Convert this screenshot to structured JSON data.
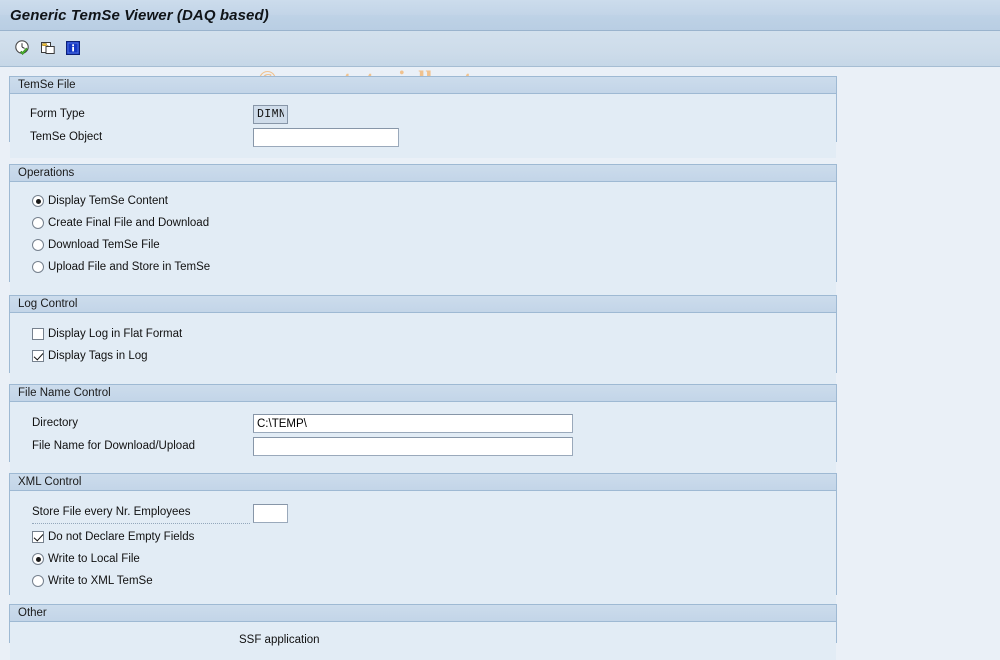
{
  "window": {
    "title": "Generic TemSe Viewer (DAQ based)"
  },
  "watermark": {
    "text": "© www.tutorialkart.com",
    "color": "#f0c28f"
  },
  "toolbar": {
    "items": [
      {
        "name": "execute-icon",
        "tooltip": "Execute"
      },
      {
        "name": "copy-icon",
        "tooltip": "Copy"
      },
      {
        "name": "info-icon",
        "tooltip": "Information"
      }
    ]
  },
  "sections": {
    "temse_file": {
      "header": "TemSe File",
      "form_type_label": "Form Type",
      "form_type_value": "DIMN",
      "temse_object_label": "TemSe Object",
      "temse_object_value": "",
      "temse_object_placeholder": ""
    },
    "operations": {
      "header": "Operations",
      "options": [
        {
          "label": "Display TemSe Content",
          "selected": true
        },
        {
          "label": "Create Final File and Download",
          "selected": false
        },
        {
          "label": "Download TemSe File",
          "selected": false
        },
        {
          "label": "Upload File and Store in TemSe",
          "selected": false
        }
      ]
    },
    "log_control": {
      "header": "Log Control",
      "options": [
        {
          "label": "Display Log in Flat Format",
          "checked": false
        },
        {
          "label": "Display Tags in Log",
          "checked": true
        }
      ]
    },
    "file_name_control": {
      "header": "File Name Control",
      "directory_label": "Directory",
      "directory_value": "C:\\TEMP\\",
      "filename_label": "File Name for Download/Upload",
      "filename_value": "",
      "filename_placeholder": ""
    },
    "xml_control": {
      "header": "XML Control",
      "store_file_label": "Store File every Nr. Employees",
      "store_file_value": "",
      "store_file_placeholder": "",
      "checkbox": {
        "label": "Do not Declare Empty Fields",
        "checked": true
      },
      "radios": [
        {
          "label": "Write to Local File",
          "selected": true
        },
        {
          "label": "Write to XML TemSe",
          "selected": false
        }
      ]
    },
    "other": {
      "header": "Other",
      "ssf_application_label": "SSF application"
    }
  },
  "colors": {
    "page_background": "#eaf0f7",
    "panel_background": "#e2ecf5",
    "panel_header": "#c6d8e9",
    "panel_border": "#9eb9d3",
    "title_bar": "#c3d5e8"
  }
}
